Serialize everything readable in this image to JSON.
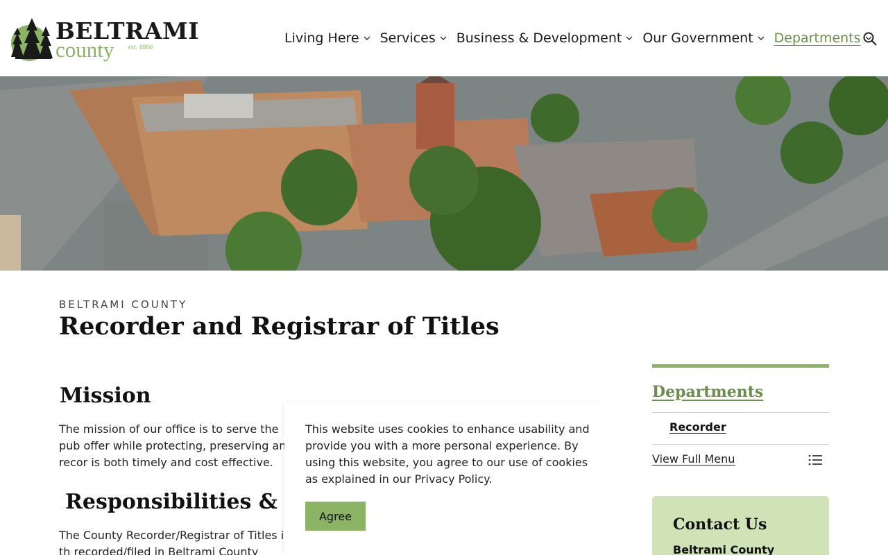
{
  "header": {
    "logo_title": "BELTRAMI",
    "logo_sub": "county",
    "logo_est": "est. 1866",
    "nav": [
      {
        "label": "Living Here"
      },
      {
        "label": "Services"
      },
      {
        "label": "Business & Development"
      },
      {
        "label": "Our Government"
      },
      {
        "label": "Departments"
      }
    ],
    "search_icon": "search-icon"
  },
  "main": {
    "eyebrow": "BELTRAMI COUNTY",
    "title": "Recorder and Registrar of Titles",
    "mission_heading": "Mission",
    "mission_text": "The mission of our office is to serve the pub offer while protecting, preserving and recor is both timely and cost effective.",
    "responsibilities_heading": "Responsibilities & Se",
    "responsibilities_text": "The County Recorder/Registrar of Titles is th recorded/filed in Beltrami County pertaining"
  },
  "cookie": {
    "text": "This website uses cookies to enhance usability and provide you with a more personal experience. By using this website, you agree to our use of cookies as explained in our Privacy Policy.",
    "agree_label": "Agree"
  },
  "sidebar": {
    "title": "Departments",
    "item": "Recorder",
    "full_menu": "View Full Menu",
    "contact_title": "Contact Us",
    "contact_org": "Beltrami County"
  },
  "colors": {
    "accent_green": "#8bb464",
    "link_green": "#6b8f4a",
    "contact_bg": "#cfe3b6"
  }
}
